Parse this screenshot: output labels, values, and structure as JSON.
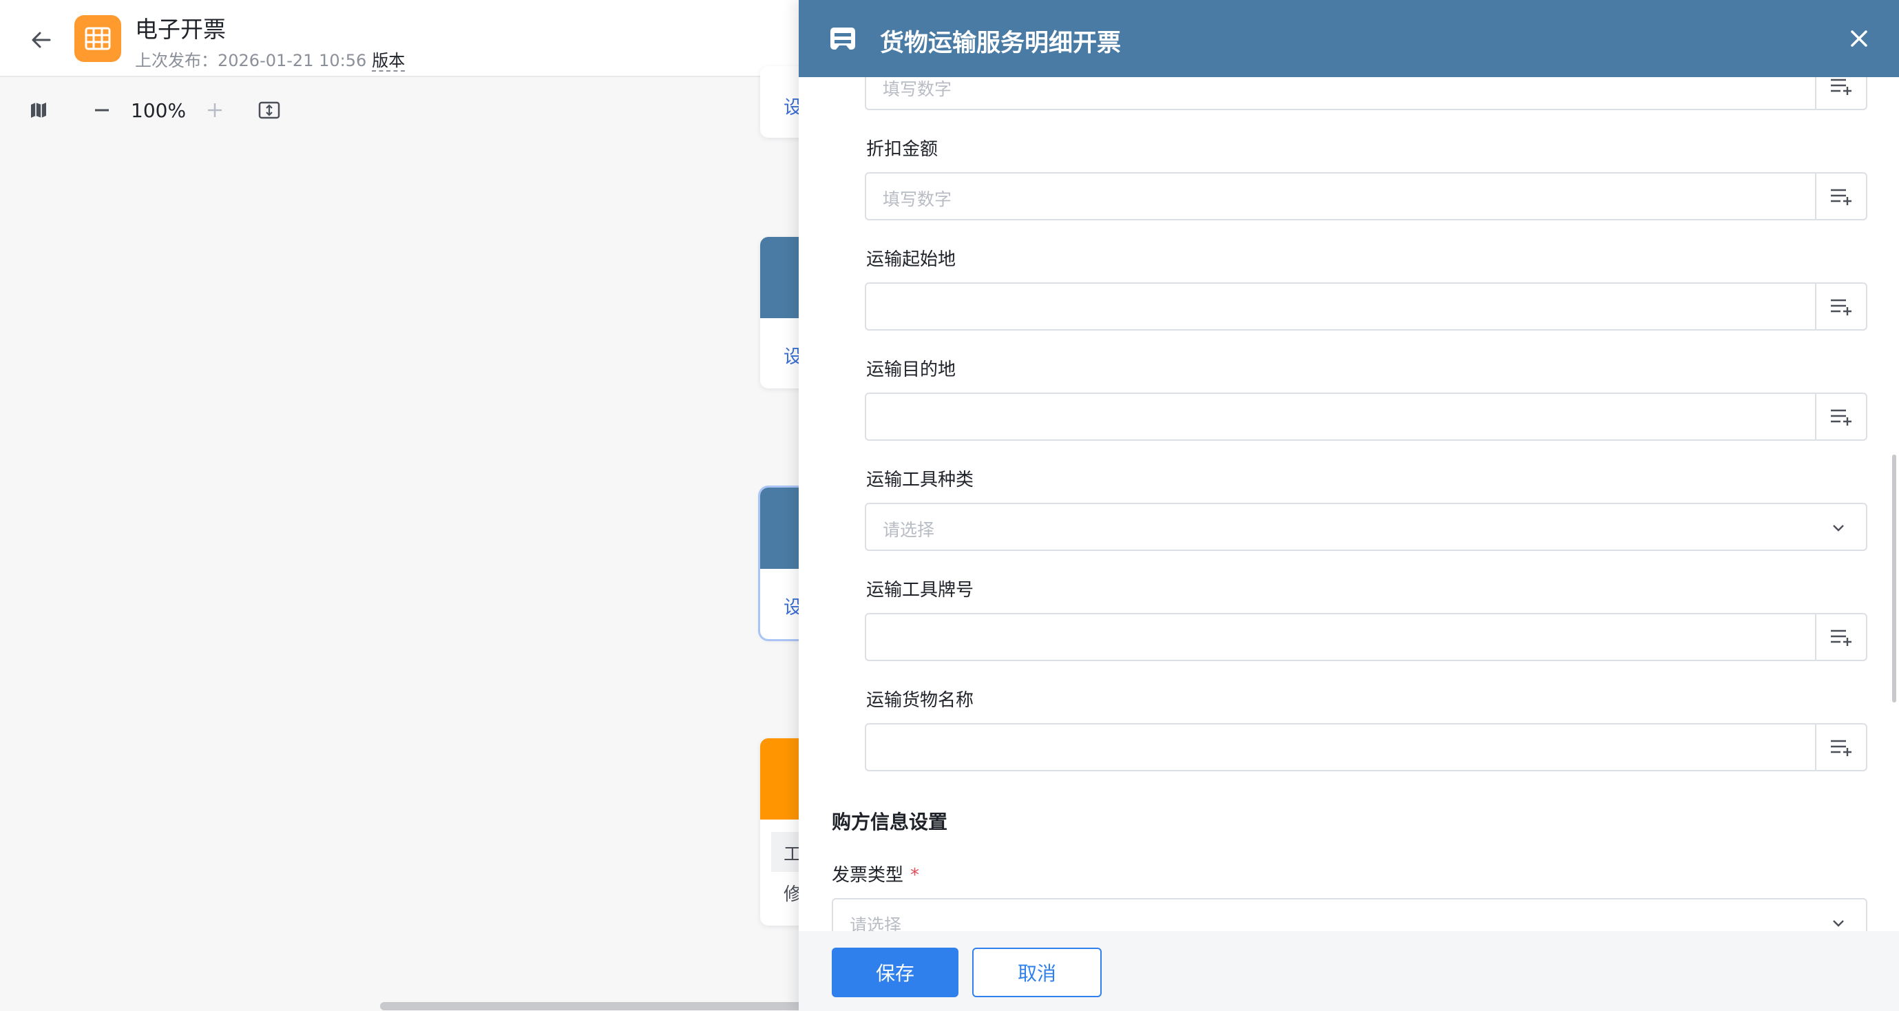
{
  "header": {
    "title": "电子开票",
    "last_publish": "上次发布：2026-01-21 10:56",
    "version_link": "版本"
  },
  "toolbar": {
    "zoom": "100%"
  },
  "canvas": {
    "node_links": [
      "设",
      "设",
      "设"
    ],
    "node4_line1": "工",
    "node4_line2": "修"
  },
  "drawer": {
    "title": "货物运输服务明细开票",
    "number_placeholder": "填写数字",
    "fields": {
      "discount": {
        "label": "折扣金额",
        "placeholder": "填写数字"
      },
      "origin": {
        "label": "运输起始地"
      },
      "destination": {
        "label": "运输目的地"
      },
      "vehicle_type": {
        "label": "运输工具种类",
        "placeholder": "请选择"
      },
      "vehicle_plate": {
        "label": "运输工具牌号"
      },
      "goods_name": {
        "label": "运输货物名称"
      }
    },
    "buyer_section": {
      "title": "购方信息设置",
      "invoice_type": {
        "label": "发票类型",
        "required_mark": "*",
        "placeholder": "请选择"
      }
    },
    "footer": {
      "save": "保存",
      "cancel": "取消"
    }
  },
  "colors": {
    "drawer_header": "#4a7ba4",
    "app_icon": "#ff9a2e",
    "primary": "#2f80ed",
    "node_orange": "#ff9500"
  },
  "icons": {
    "back": "arrow-left-icon",
    "app": "table-grid-icon",
    "map": "map-icon",
    "zoom_out": "minus-icon",
    "zoom_in": "plus-icon",
    "fit": "fit-screen-icon",
    "drawer": "document-icon",
    "close": "close-icon",
    "addon": "list-add-icon",
    "dropdown": "chevron-down-icon"
  }
}
